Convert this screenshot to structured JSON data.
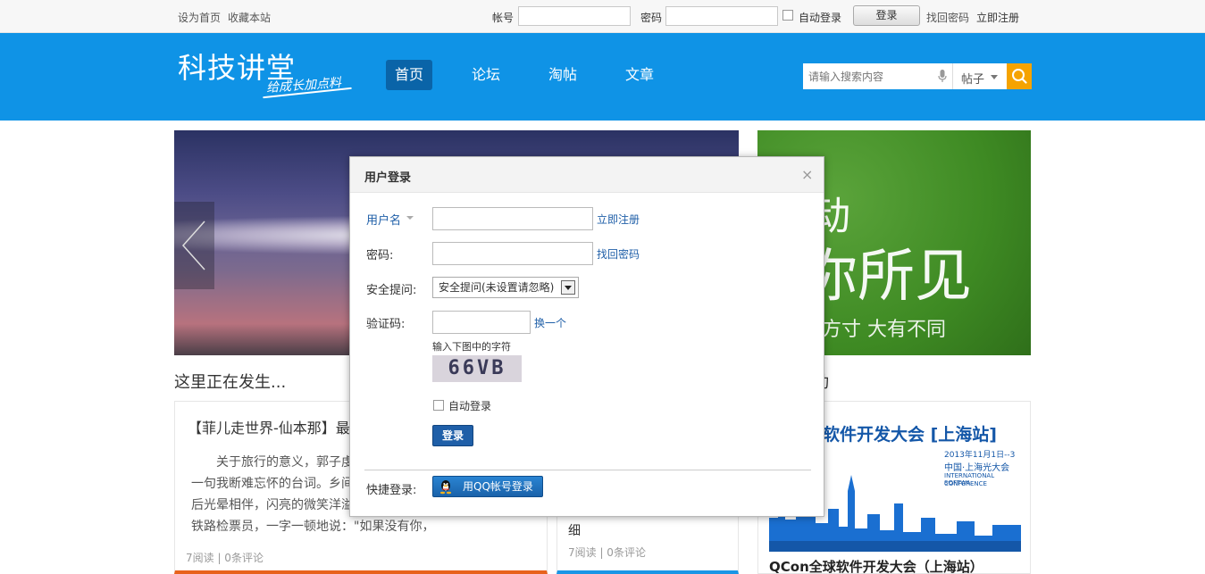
{
  "topbar": {
    "set_home": "设为首页",
    "bookmark": "收藏本站",
    "account_label": "帐号",
    "password_label": "密码",
    "auto_login": "自动登录",
    "login_button": "登录",
    "find_password": "找回密码",
    "register": "立即注册"
  },
  "header": {
    "logo": "科技讲堂",
    "slogan": "给成长加点料",
    "nav": [
      "首页",
      "论坛",
      "淘帖",
      "文章"
    ],
    "search_placeholder": "请输入搜索内容",
    "search_scope": "帖子"
  },
  "banner": {
    "right_line1": "动",
    "right_line2": "你所见",
    "right_line3": "方寸 大有不同"
  },
  "sections": {
    "happening": "这里正在发生..."
  },
  "cards": {
    "card1_title": "【菲儿走世界-仙本那】最",
    "card1_lines": [
      "关于旅行的意义，郭子虔",
      "一句我断难忘怀的台词。乡间",
      "后光晕相伴，闪亮的微笑洋溢",
      "铁路检票员，一字一顿地说：\"如果没有你，"
    ],
    "card1_meta": "7阅读 | 0条评论",
    "card2_title_tail": "细",
    "card2_meta": "7阅读 | 0条评论",
    "card3_banner_title": "软件开发大会 [上海站]",
    "card3_banner_date": "2013年11月1日--3",
    "card3_banner_place": "中国·上海光大会",
    "card3_banner_en1": "INTERNATIONAL SOFTWA",
    "card3_banner_en2": "CONFERENCE",
    "card3_title": "QCon全球软件开发大会（上海站）"
  },
  "modal": {
    "title": "用户登录",
    "close": "×",
    "username_label": "用户名",
    "register_link": "立即注册",
    "password_label": "密码:",
    "find_password_link": "找回密码",
    "security_label": "安全提问:",
    "security_value": "安全提问(未设置请忽略)",
    "captcha_label": "验证码:",
    "captcha_change": "换一个",
    "captcha_hint": "输入下图中的字符",
    "captcha_text": "66VB",
    "auto_login": "自动登录",
    "login_button": "登录",
    "quick_login_label": "快捷登录:",
    "qq_login": "用QQ帐号登录"
  }
}
